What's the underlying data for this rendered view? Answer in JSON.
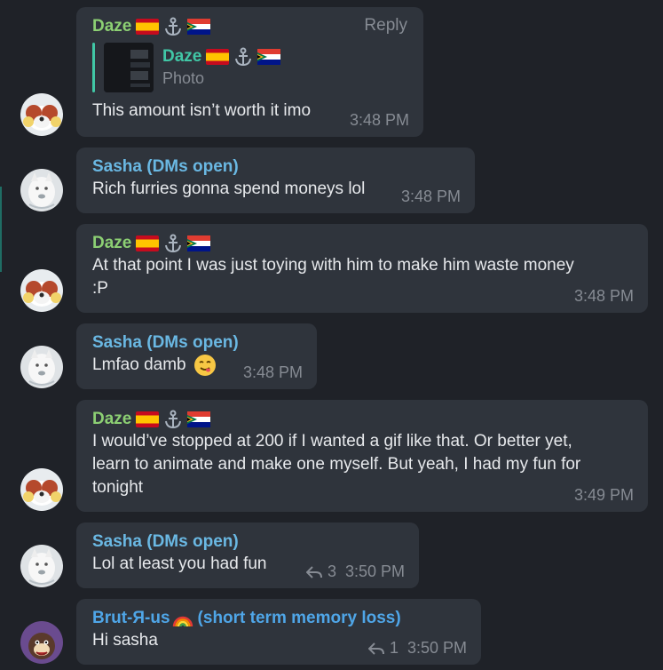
{
  "messages": [
    {
      "sender": "Daze",
      "reply_label": "Reply",
      "quote": {
        "name": "Daze",
        "kind": "Photo"
      },
      "text": "This amount isn’t worth it imo",
      "time": "3:48 PM"
    },
    {
      "sender": "Sasha (DMs open)",
      "text": "Rich furries gonna spend moneys lol",
      "time": "3:48 PM"
    },
    {
      "sender": "Daze",
      "lines": [
        "At that point I was just toying with him to make him waste money",
        ":P"
      ],
      "time": "3:48 PM"
    },
    {
      "sender": "Sasha (DMs open)",
      "text": "Lmfao damb",
      "time": "3:48 PM"
    },
    {
      "sender": "Daze",
      "lines": [
        "I would’ve stopped at 200 if I wanted a gif like that. Or better yet,",
        "learn to animate and make one myself. But yeah, I had my fun for",
        "tonight"
      ],
      "time": "3:49 PM"
    },
    {
      "sender": "Sasha (DMs open)",
      "text": "Lol at least you had fun",
      "replies": "3",
      "time": "3:50 PM"
    },
    {
      "sender_prefix": "Brut-Я-us",
      "sender_suffix": "(short term memory loss)",
      "text": "Hi sasha",
      "replies": "1",
      "time": "3:50 PM"
    }
  ],
  "colors": {
    "background": "#1f2228",
    "bubble": "#2f343c",
    "daze_name": "#8ccf73",
    "sasha_name": "#6ab8e3",
    "brut_name": "#4fa6e8",
    "quote_accent": "#41c7a6",
    "meta_text": "#868b93"
  },
  "icons": {
    "flag": "spain-flag-icon",
    "anchor": "anchor-icon",
    "flag2": "south-africa-flag-icon",
    "rainbow": "rainbow-icon",
    "reply": "reply-arrow-icon",
    "emoji": "yum-face-emoji-icon"
  }
}
